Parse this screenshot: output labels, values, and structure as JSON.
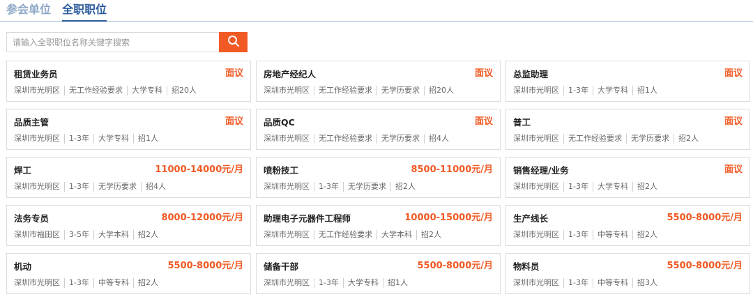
{
  "tabs": {
    "org_label": "参会单位",
    "job_label": "全职职位"
  },
  "search": {
    "placeholder": "请输入全职职位名称关键字搜索",
    "icon": "search-icon",
    "button_color": "#f15a24"
  },
  "colors": {
    "accent": "#f15a24",
    "tab_active": "#2b5a9c",
    "tab_inactive": "#8ea7c8"
  },
  "jobs": [
    {
      "title": "租赁业务员",
      "salary": "面议",
      "location": "深圳市光明区",
      "experience": "无工作经验要求",
      "education": "大学专科",
      "headcount": "招20人"
    },
    {
      "title": "房地产经纪人",
      "salary": "面议",
      "location": "深圳市光明区",
      "experience": "无工作经验要求",
      "education": "无学历要求",
      "headcount": "招20人"
    },
    {
      "title": "总监助理",
      "salary": "面议",
      "location": "深圳市光明区",
      "experience": "1-3年",
      "education": "大学专科",
      "headcount": "招1人"
    },
    {
      "title": "品质主管",
      "salary": "面议",
      "location": "深圳市光明区",
      "experience": "1-3年",
      "education": "大学专科",
      "headcount": "招1人"
    },
    {
      "title": "品质QC",
      "salary": "面议",
      "location": "深圳市光明区",
      "experience": "无工作经验要求",
      "education": "无学历要求",
      "headcount": "招4人"
    },
    {
      "title": "普工",
      "salary": "面议",
      "location": "深圳市光明区",
      "experience": "无工作经验要求",
      "education": "无学历要求",
      "headcount": "招2人"
    },
    {
      "title": "焊工",
      "salary": "11000-14000元/月",
      "location": "深圳市光明区",
      "experience": "1-3年",
      "education": "无学历要求",
      "headcount": "招4人"
    },
    {
      "title": "喷粉技工",
      "salary": "8500-11000元/月",
      "location": "深圳市光明区",
      "experience": "1-3年",
      "education": "无学历要求",
      "headcount": "招2人"
    },
    {
      "title": "销售经理/业务",
      "salary": "面议",
      "location": "深圳市光明区",
      "experience": "1-3年",
      "education": "大学专科",
      "headcount": "招2人"
    },
    {
      "title": "法务专员",
      "salary": "8000-12000元/月",
      "location": "深圳市福田区",
      "experience": "3-5年",
      "education": "大学本科",
      "headcount": "招2人"
    },
    {
      "title": "助理电子元器件工程师",
      "salary": "10000-15000元/月",
      "location": "深圳市光明区",
      "experience": "无工作经验要求",
      "education": "大学本科",
      "headcount": "招2人"
    },
    {
      "title": "生产线长",
      "salary": "5500-8000元/月",
      "location": "深圳市光明区",
      "experience": "1-3年",
      "education": "中等专科",
      "headcount": "招2人"
    },
    {
      "title": "机动",
      "salary": "5500-8000元/月",
      "location": "深圳市光明区",
      "experience": "1-3年",
      "education": "中等专科",
      "headcount": "招2人"
    },
    {
      "title": "储备干部",
      "salary": "5500-8000元/月",
      "location": "深圳市光明区",
      "experience": "1-3年",
      "education": "大学专科",
      "headcount": "招1人"
    },
    {
      "title": "物料员",
      "salary": "5500-8000元/月",
      "location": "深圳市光明区",
      "experience": "1-3年",
      "education": "中等专科",
      "headcount": "招3人"
    }
  ]
}
